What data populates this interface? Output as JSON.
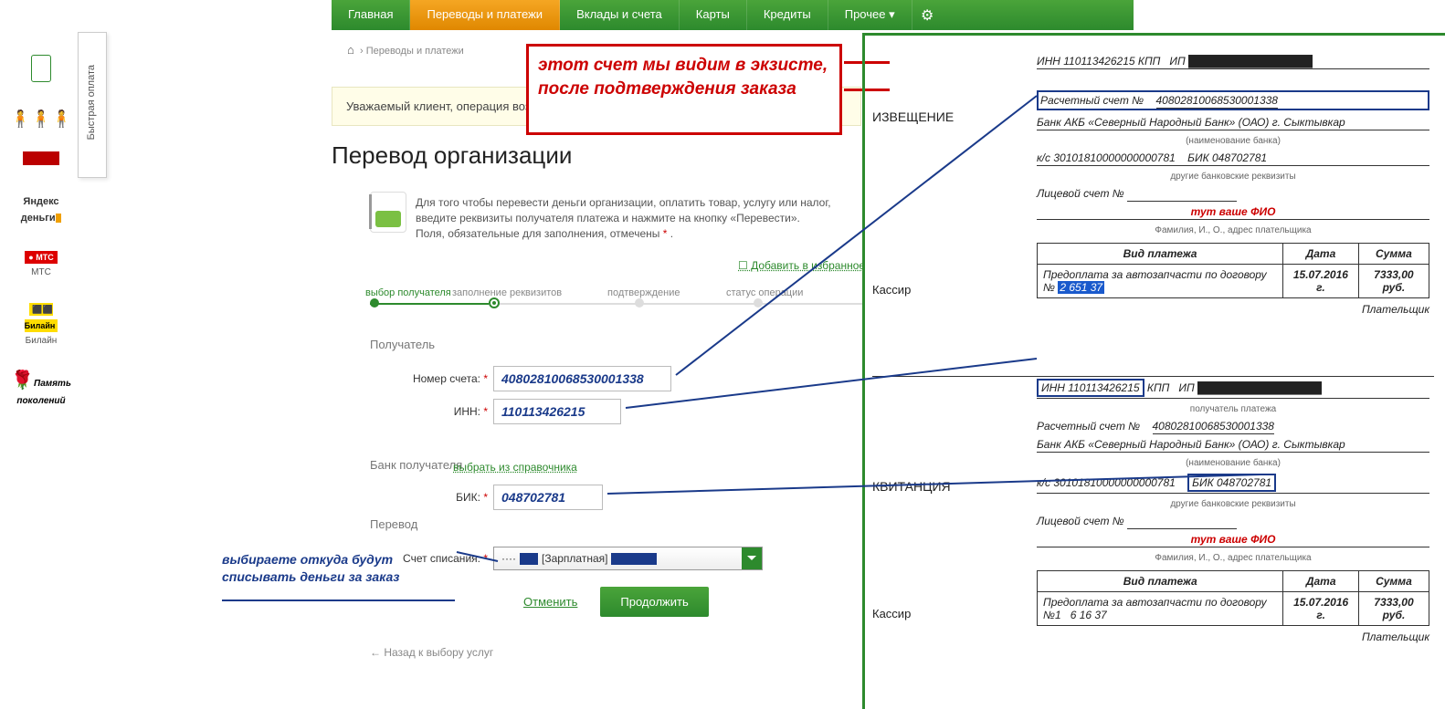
{
  "nav": {
    "tabs": [
      "Главная",
      "Переводы и платежи",
      "Вклады и счета",
      "Карты",
      "Кредиты",
      "Прочее ▾"
    ],
    "active": 1
  },
  "sidebar": {
    "fast_pay": "Быстрая оплата",
    "items": [
      {
        "label": ""
      },
      {
        "label": ""
      },
      {
        "label": ""
      },
      {
        "label": "деньги"
      },
      {
        "label": "МТС"
      },
      {
        "label": "Билайн"
      },
      {
        "label": ""
      }
    ]
  },
  "breadcrumb": {
    "home": "⌂",
    "path": "Переводы и платежи"
  },
  "alert": "Уважаемый клиент, операция возм",
  "title": "Перевод организации",
  "intro": {
    "l1": "Для того чтобы перевести деньги организации, оплатить товар, услугу или налог,",
    "l2": "введите реквизиты получателя платежа и нажмите на кнопку «Перевести».",
    "l3": "Поля, обязательные для заполнения, отмечены ",
    "ast": "*",
    "dot": " ."
  },
  "fav": "Добавить в избранное",
  "steps": [
    "выбор получателя",
    "заполнение реквизитов",
    "подтверждение",
    "статус операции"
  ],
  "sections": {
    "recv": "Получатель",
    "bank": "Банк получателя",
    "transfer": "Перевод"
  },
  "form": {
    "acct_label": "Номер счета:",
    "acct_val": "40802810068530001338",
    "inn_label": "ИНН:",
    "inn_val": "110113426215",
    "bik_label": "БИК:",
    "bik_val": "048702781",
    "ref": "выбрать из справочника",
    "debit_label": "Счет списания:",
    "debit_val": "···· ",
    "debit_card": "[Зарплатная]"
  },
  "buttons": {
    "cancel": "Отменить",
    "cont": "Продолжить"
  },
  "back": "← Назад к выбору услуг",
  "anno": {
    "red": "этот счет мы видим в экзисте, после подтверждения заказа",
    "blue": "выбираете откуда будут списывать деньги за заказ"
  },
  "receipt": {
    "izvesh": "ИЗВЕЩЕНИЕ",
    "kvit": "КВИТАНЦИЯ",
    "kassir": "Кассир",
    "inn": "ИНН 110113426215",
    "kpp": "КПП",
    "ip": "ИП",
    "poluch_sub": "получатель платежа",
    "rs_label": "Расчетный счет №",
    "rs_val": "40802810068530001338",
    "bank": "Банк АКБ «Северный Народный Банк» (ОАО) г. Сыктывкар",
    "bank_sub": "(наименование банка)",
    "ks_label": "к/с",
    "ks_val": "30101810000000000781",
    "bik_label": "БИК",
    "bik_val": "048702781",
    "other_sub": "другие банковские реквизиты",
    "ls_label": "Лицевой счет №",
    "fio": "тут ваше ФИО",
    "fio_sub": "Фамилия, И., О., адрес плательщика",
    "th_type": "Вид платежа",
    "th_date": "Дата",
    "th_sum": "Сумма",
    "td_type": "Предоплата за автозапчасти по договору №",
    "td_type2": "Предоплата за автозапчасти по договору №1",
    "td_num": "2 651 37",
    "td_num2": "6 16 37",
    "td_date": "15.07.2016 г.",
    "td_sum": "7333,00 руб.",
    "payer": "Плательщик"
  }
}
